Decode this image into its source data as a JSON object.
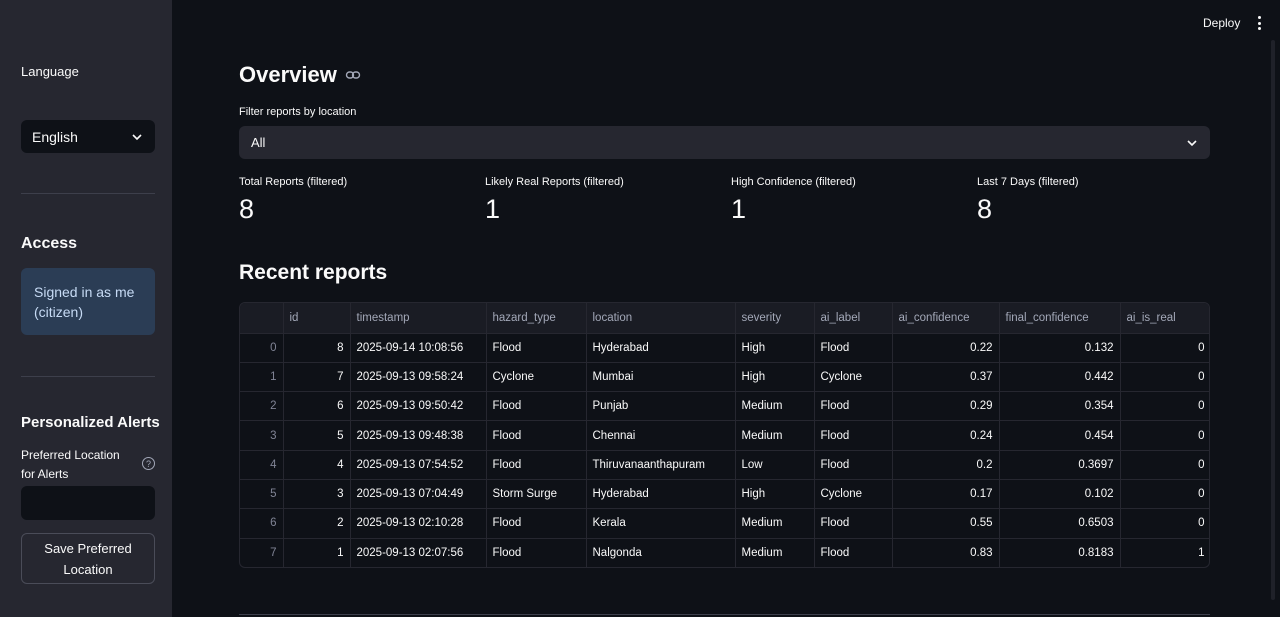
{
  "sidebar": {
    "language_label": "Language",
    "language_value": "English",
    "access_heading": "Access",
    "signed_in_text": "Signed in as me (citizen)",
    "alerts_heading": "Personalized Alerts",
    "pref_location_label": "Preferred Location for Alerts",
    "pref_location_value": "",
    "save_button_label": "Save Preferred Location"
  },
  "topbar": {
    "deploy_label": "Deploy"
  },
  "main": {
    "overview_heading": "Overview",
    "filter_label": "Filter reports by location",
    "filter_value": "All",
    "metrics": [
      {
        "label": "Total Reports (filtered)",
        "value": "8"
      },
      {
        "label": "Likely Real Reports (filtered)",
        "value": "1"
      },
      {
        "label": "High Confidence (filtered)",
        "value": "1"
      },
      {
        "label": "Last 7 Days (filtered)",
        "value": "8"
      }
    ],
    "recent_heading": "Recent reports",
    "table": {
      "columns": [
        "",
        "id",
        "timestamp",
        "hazard_type",
        "location",
        "severity",
        "ai_label",
        "ai_confidence",
        "final_confidence",
        "ai_is_real"
      ],
      "rows": [
        [
          "0",
          "8",
          "2025-09-14 10:08:56",
          "Flood",
          "Hyderabad",
          "High",
          "Flood",
          "0.22",
          "0.132",
          "0"
        ],
        [
          "1",
          "7",
          "2025-09-13 09:58:24",
          "Cyclone",
          "Mumbai",
          "High",
          "Cyclone",
          "0.37",
          "0.442",
          "0"
        ],
        [
          "2",
          "6",
          "2025-09-13 09:50:42",
          "Flood",
          "Punjab",
          "Medium",
          "Flood",
          "0.29",
          "0.354",
          "0"
        ],
        [
          "3",
          "5",
          "2025-09-13 09:48:38",
          "Flood",
          "Chennai",
          "Medium",
          "Flood",
          "0.24",
          "0.454",
          "0"
        ],
        [
          "4",
          "4",
          "2025-09-13 07:54:52",
          "Flood",
          "Thiruvanaanthapuram",
          "Low",
          "Flood",
          "0.2",
          "0.3697",
          "0"
        ],
        [
          "5",
          "3",
          "2025-09-13 07:04:49",
          "Storm Surge",
          "Hyderabad",
          "High",
          "Cyclone",
          "0.17",
          "0.102",
          "0"
        ],
        [
          "6",
          "2",
          "2025-09-13 02:10:28",
          "Flood",
          "Kerala",
          "Medium",
          "Flood",
          "0.55",
          "0.6503",
          "0"
        ],
        [
          "7",
          "1",
          "2025-09-13 02:07:56",
          "Flood",
          "Nalgonda",
          "Medium",
          "Flood",
          "0.83",
          "0.8183",
          "1"
        ]
      ]
    }
  }
}
